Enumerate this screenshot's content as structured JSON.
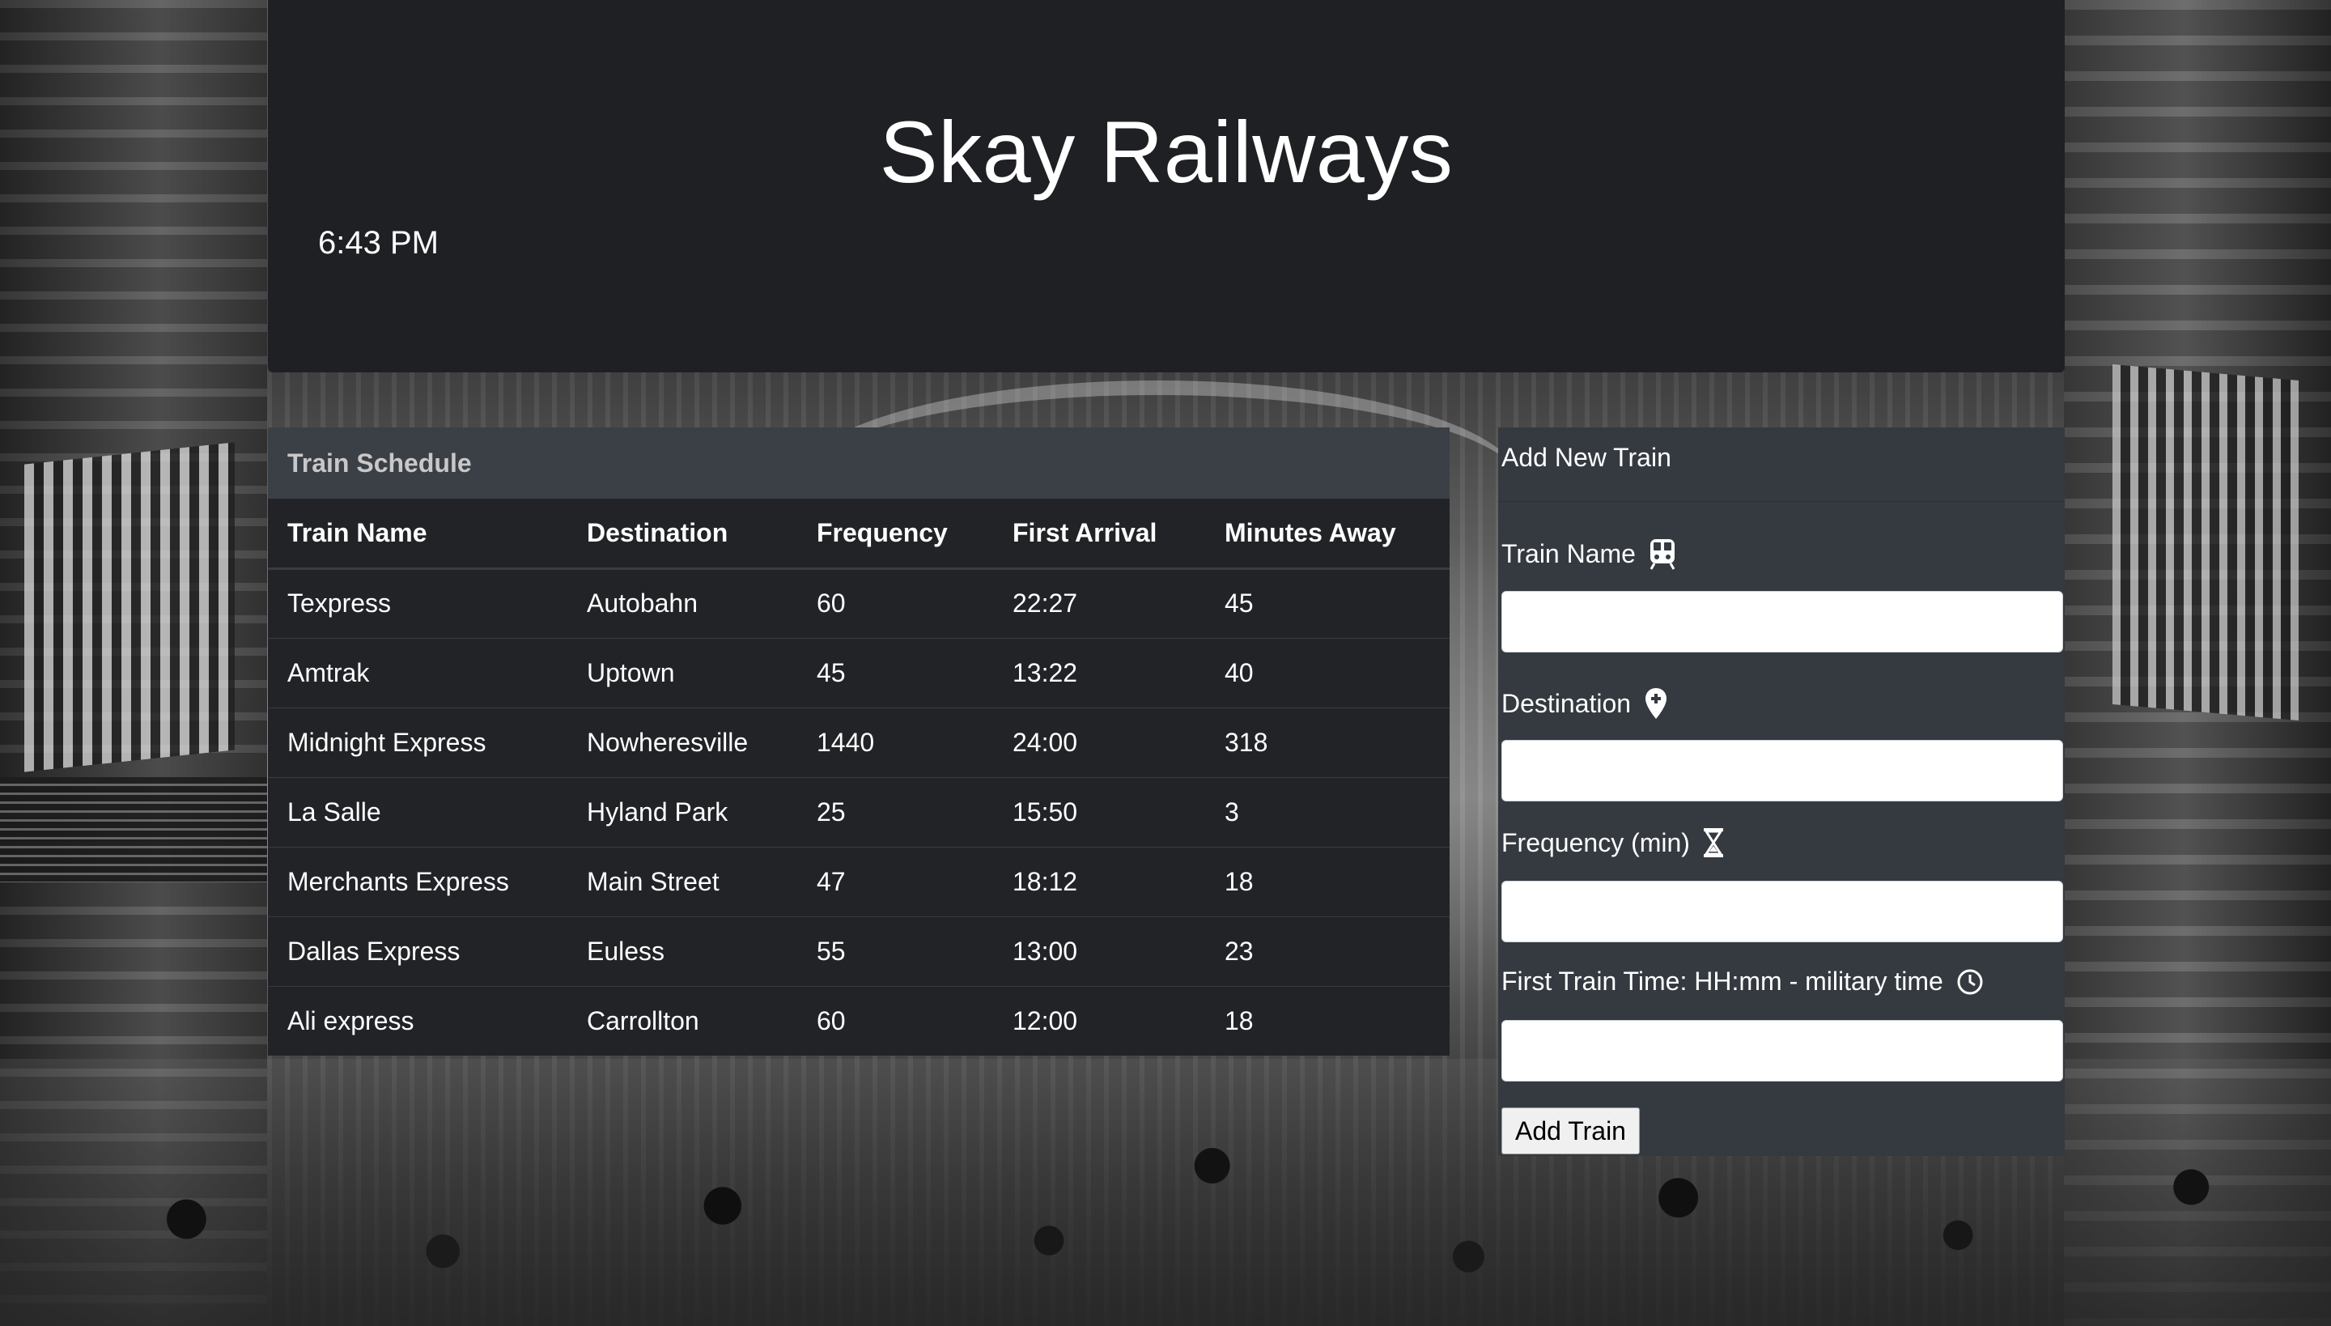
{
  "header": {
    "title": "Skay Railways",
    "time": "6:43 PM"
  },
  "schedule": {
    "title": "Train Schedule",
    "columns": [
      "Train Name",
      "Destination",
      "Frequency",
      "First Arrival",
      "Minutes Away"
    ],
    "rows": [
      [
        "Texpress",
        "Autobahn",
        "60",
        "22:27",
        "45"
      ],
      [
        "Amtrak",
        "Uptown",
        "45",
        "13:22",
        "40"
      ],
      [
        "Midnight Express",
        "Nowheresville",
        "1440",
        "24:00",
        "318"
      ],
      [
        "La Salle",
        "Hyland Park",
        "25",
        "15:50",
        "3"
      ],
      [
        "Merchants Express",
        "Main Street",
        "47",
        "18:12",
        "18"
      ],
      [
        "Dallas Express",
        "Euless",
        "55",
        "13:00",
        "23"
      ],
      [
        "Ali express",
        "Carrollton",
        "60",
        "12:00",
        "18"
      ]
    ]
  },
  "form": {
    "title": "Add New Train",
    "fields": [
      {
        "label": "Train Name",
        "icon": "train-icon",
        "value": ""
      },
      {
        "label": "Destination",
        "icon": "map-marker-icon",
        "value": ""
      },
      {
        "label": "Frequency (min)",
        "icon": "hourglass-icon",
        "value": ""
      },
      {
        "label": "First Train Time: HH:mm - military time",
        "icon": "clock-icon",
        "value": ""
      }
    ],
    "submit_label": "Add Train"
  },
  "colors": {
    "header_bg": "#1f2024",
    "table_bg": "#212327",
    "table_title_bg": "#3b3f46",
    "form_bg": "#343a40"
  }
}
